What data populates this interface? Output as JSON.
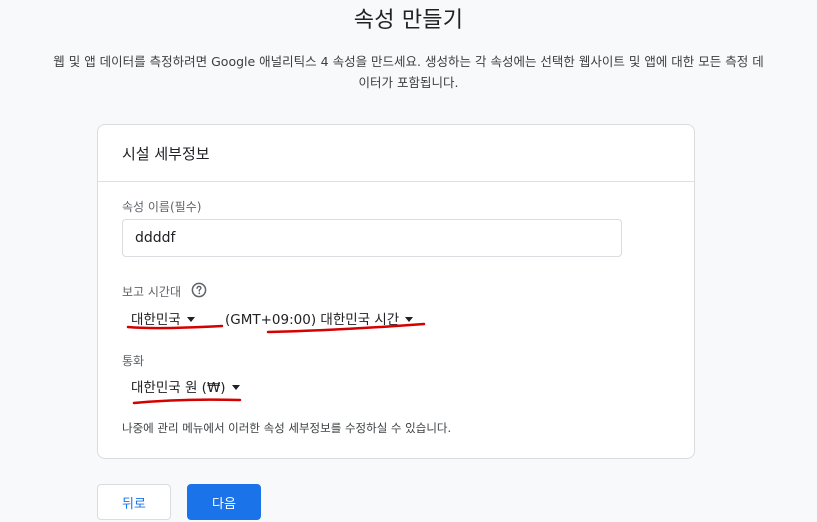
{
  "page": {
    "title": "속성 만들기",
    "description_line1": "웹 및 앱 데이터를 측정하려면 Google 애널리틱스 4 속성을 만드세요. 생성하는 각 속성에는 선택한 웹사이트 및 앱에 대한 모든 측정 데",
    "description_line2": "이터가 포함됩니다."
  },
  "card": {
    "header": "시설 세부정보",
    "property_name": {
      "label": "속성 이름(필수)",
      "value": "ddddf"
    },
    "reporting_timezone": {
      "label": "보고 시간대",
      "help_icon": "help-circle-icon",
      "country": "대한민국",
      "timezone": "(GMT+09:00) 대한민국 시간"
    },
    "currency": {
      "label": "통화",
      "value": "대한민국 원 (₩)"
    },
    "note": "나중에 관리 메뉴에서 이러한 속성 세부정보를 수정하실 수 있습니다."
  },
  "buttons": {
    "back": "뒤로",
    "next": "다음"
  },
  "colors": {
    "primary": "#1a73e8",
    "annotation_underline": "#d50000"
  }
}
